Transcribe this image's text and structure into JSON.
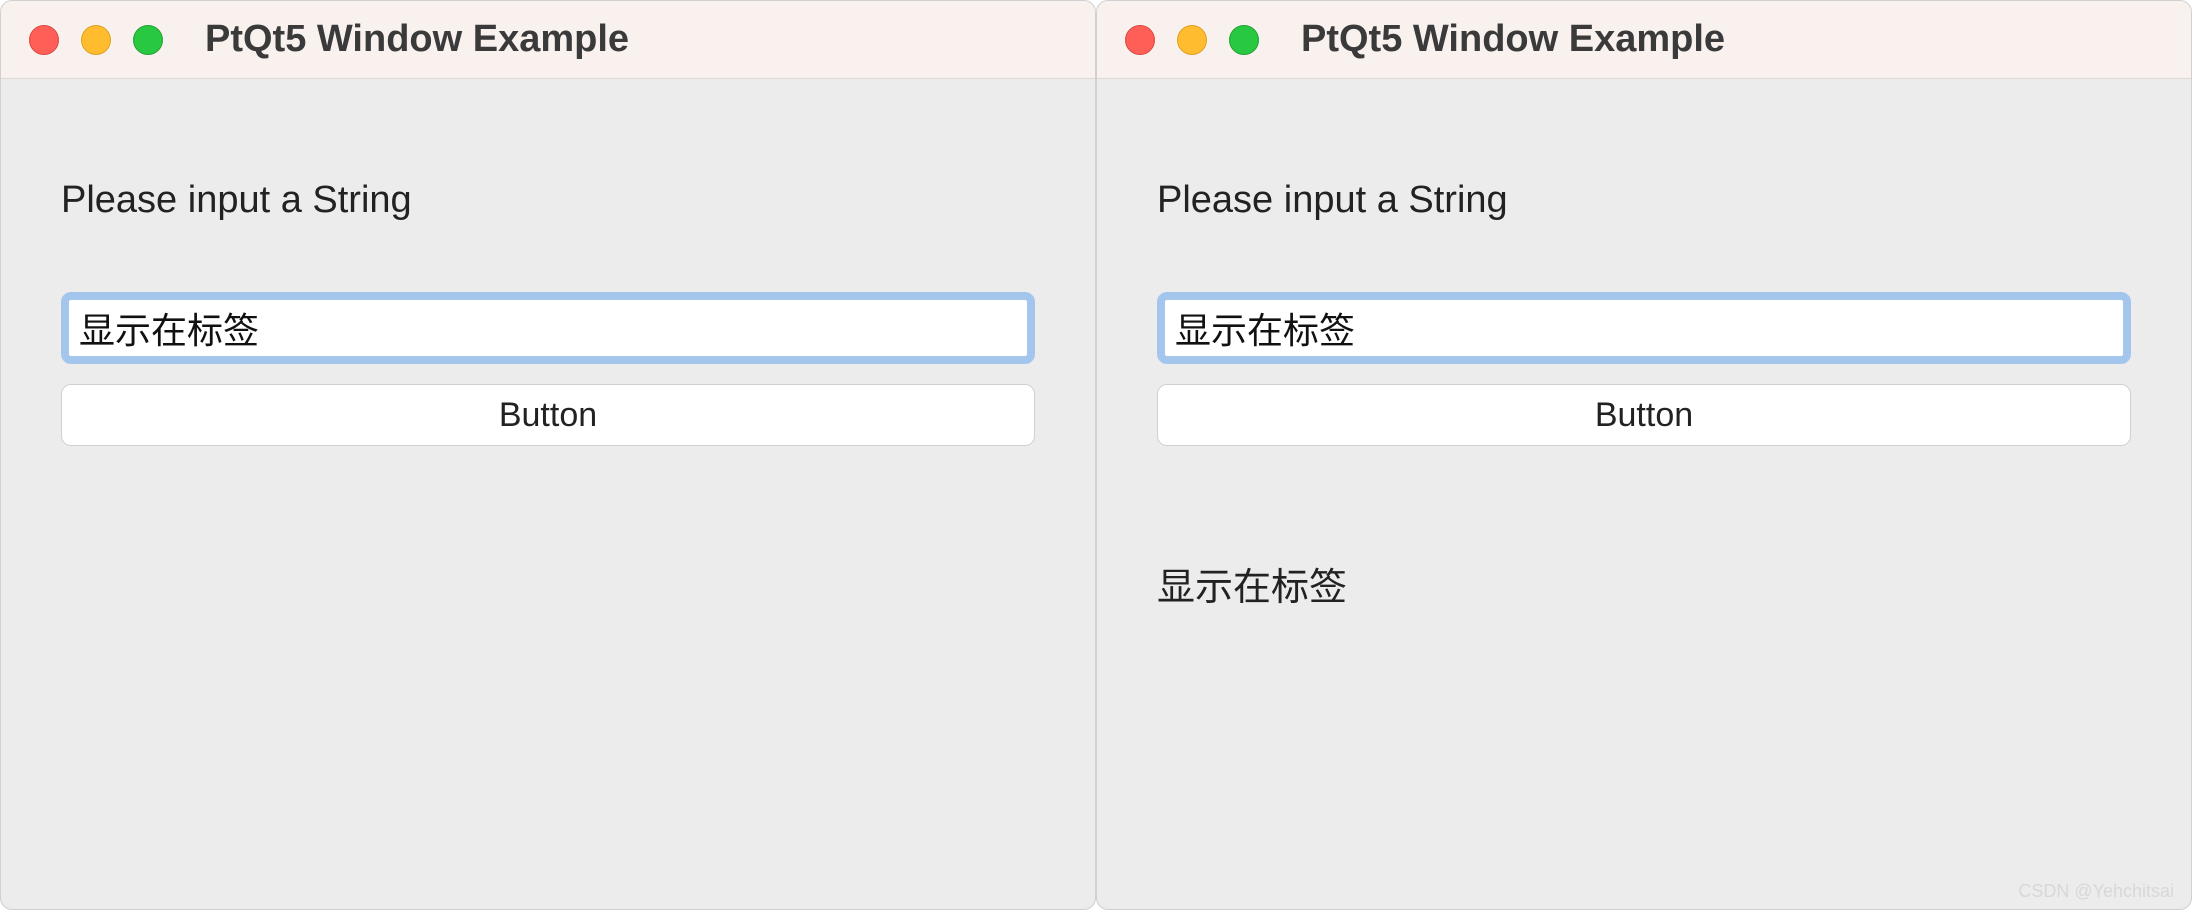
{
  "windows": [
    {
      "title": "PtQt5 Window Example",
      "prompt": "Please input a String",
      "input_value": "显示在标签",
      "button_label": "Button",
      "output_text": "",
      "has_cursor": true
    },
    {
      "title": "PtQt5 Window Example",
      "prompt": "Please input a String",
      "input_value": "显示在标签",
      "button_label": "Button",
      "output_text": "显示在标签",
      "has_cursor": false
    }
  ],
  "watermark": "CSDN @Yehchitsai"
}
